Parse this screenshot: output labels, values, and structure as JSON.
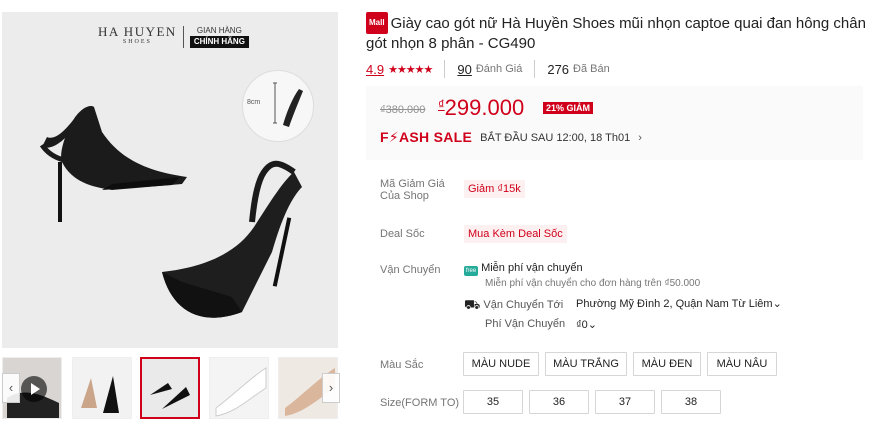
{
  "gallery": {
    "brand_name": "HA HUYEN",
    "brand_sub": "SHOES",
    "brand_tag_top": "GIAN HÀNG",
    "brand_tag_bottom": "CHÍNH HÃNG",
    "heel_height": "8cm",
    "prev_arrow": "‹",
    "next_arrow": "›"
  },
  "product": {
    "mall_badge": "Mall",
    "title": "Giày cao gót nữ Hà Huyền Shoes mũi nhọn captoe quai đan hông chân gót nhọn 8 phân - CG490",
    "rating": "4.9",
    "stars": "★★★★★",
    "reviews_count": "90",
    "reviews_label": "Đánh Giá",
    "sold_count": "276",
    "sold_label": "Đã Bán"
  },
  "price": {
    "old": "₫380.000",
    "currency": "₫",
    "current": "299.000",
    "discount": "21% GIẢM",
    "flash_logo": "F⚡ASH SALE",
    "flash_time": "BẮT ĐẦU SAU 12:00, 18 Th01",
    "flash_arrow": "›"
  },
  "voucher": {
    "label": "Mã Giảm Giá Của Shop",
    "value": "Giảm ₫15k"
  },
  "deal": {
    "label": "Deal Sốc",
    "value": "Mua Kèm Deal Sốc"
  },
  "shipping": {
    "label": "Vận Chuyển",
    "free_icon": "free",
    "free": "Miễn phí vận chuyển",
    "free_note": "Miễn phí vận chuyển cho đơn hàng trên ₫50.000",
    "to_label": "Vận Chuyển Tới",
    "to_value": "Phường Mỹ Đình 2, Quận Nam Từ Liêm",
    "fee_label": "Phí Vận Chuyển",
    "fee_value": "₫0",
    "dropdown": "⌄"
  },
  "color": {
    "label": "Màu Sắc",
    "options": [
      "MÀU NUDE",
      "MÀU TRẮNG",
      "MÀU ĐEN",
      "MÀU NÂU"
    ]
  },
  "size": {
    "label": "Size(FORM TO)",
    "options": [
      "35",
      "36",
      "37",
      "38"
    ]
  },
  "colors": {
    "accent": "#d0011b",
    "ship": "#26aa99"
  }
}
